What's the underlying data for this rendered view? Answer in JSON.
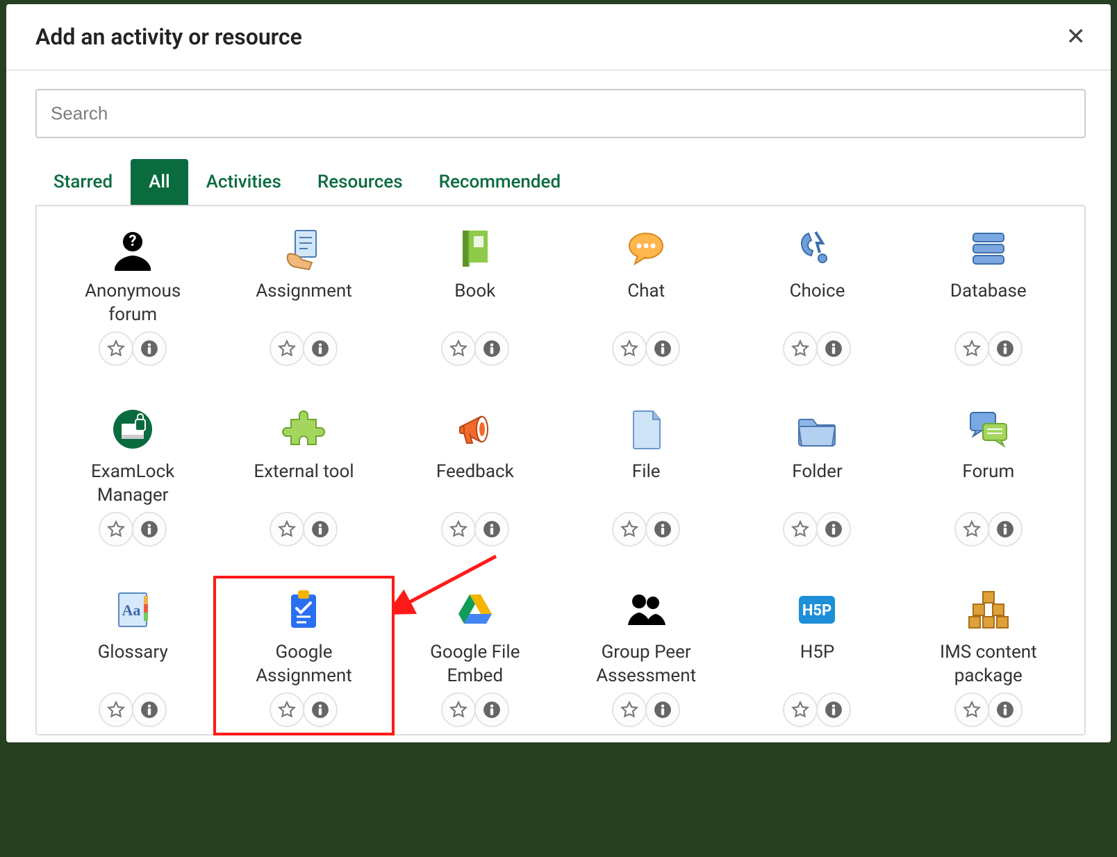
{
  "modal": {
    "title": "Add an activity or resource",
    "close_label": "Close"
  },
  "search": {
    "placeholder": "Search",
    "value": ""
  },
  "tabs": [
    {
      "id": "starred",
      "label": "Starred",
      "active": false
    },
    {
      "id": "all",
      "label": "All",
      "active": true
    },
    {
      "id": "activities",
      "label": "Activities",
      "active": false
    },
    {
      "id": "resources",
      "label": "Resources",
      "active": false
    },
    {
      "id": "recommended",
      "label": "Recommended",
      "active": false
    }
  ],
  "activities": [
    {
      "id": "anonymous-forum",
      "label": "Anonymous\nforum",
      "icon": "anon-forum"
    },
    {
      "id": "assignment",
      "label": "Assignment",
      "icon": "assignment"
    },
    {
      "id": "book",
      "label": "Book",
      "icon": "book"
    },
    {
      "id": "chat",
      "label": "Chat",
      "icon": "chat"
    },
    {
      "id": "choice",
      "label": "Choice",
      "icon": "choice"
    },
    {
      "id": "database",
      "label": "Database",
      "icon": "database"
    },
    {
      "id": "examlock-manager",
      "label": "ExamLock\nManager",
      "icon": "examlock"
    },
    {
      "id": "external-tool",
      "label": "External tool",
      "icon": "external-tool"
    },
    {
      "id": "feedback",
      "label": "Feedback",
      "icon": "feedback"
    },
    {
      "id": "file",
      "label": "File",
      "icon": "file"
    },
    {
      "id": "folder",
      "label": "Folder",
      "icon": "folder"
    },
    {
      "id": "forum",
      "label": "Forum",
      "icon": "forum"
    },
    {
      "id": "glossary",
      "label": "Glossary",
      "icon": "glossary"
    },
    {
      "id": "google-assignment",
      "label": "Google\nAssignment",
      "icon": "google-assignment",
      "highlighted": true
    },
    {
      "id": "google-file-embed",
      "label": "Google File\nEmbed",
      "icon": "google-file-embed"
    },
    {
      "id": "group-peer-assessment",
      "label": "Group Peer\nAssessment",
      "icon": "group-peer"
    },
    {
      "id": "h5p",
      "label": "H5P",
      "icon": "h5p"
    },
    {
      "id": "ims-content-package",
      "label": "IMS content\npackage",
      "icon": "ims"
    }
  ],
  "annotations": {
    "highlight_target": "google-assignment",
    "arrow_color": "#ff1a1a"
  }
}
